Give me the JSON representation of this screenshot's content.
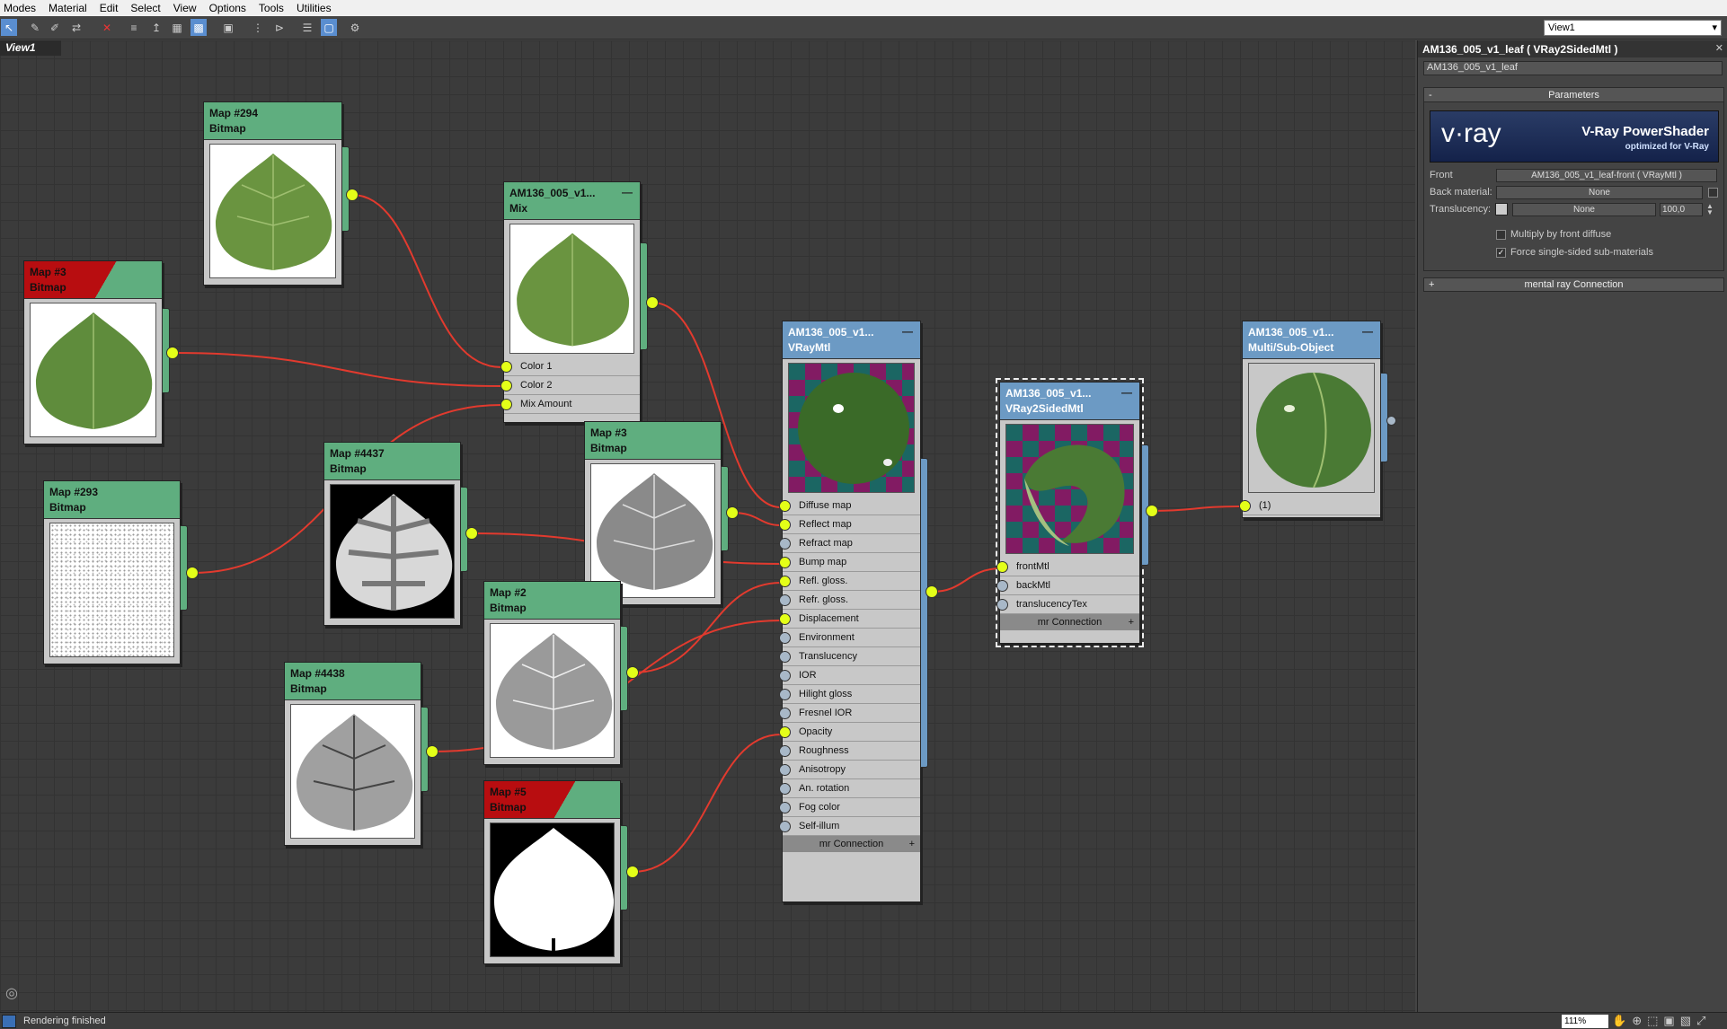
{
  "menu": [
    "Modes",
    "Material",
    "Edit",
    "Select",
    "View",
    "Options",
    "Tools",
    "Utilities"
  ],
  "view_select": "View1",
  "view_tab": "View1",
  "nodes": {
    "map294": {
      "title": "Map #294",
      "type": "Bitmap"
    },
    "map3a": {
      "title": "Map #3",
      "type": "Bitmap"
    },
    "mix": {
      "title": "AM136_005_v1...",
      "type": "Mix",
      "slots": [
        "Color 1",
        "Color 2",
        "Mix Amount"
      ]
    },
    "map293": {
      "title": "Map #293",
      "type": "Bitmap"
    },
    "map4437": {
      "title": "Map #4437",
      "type": "Bitmap"
    },
    "map3b": {
      "title": "Map #3",
      "type": "Bitmap"
    },
    "map2": {
      "title": "Map #2",
      "type": "Bitmap"
    },
    "map4438": {
      "title": "Map #4438",
      "type": "Bitmap"
    },
    "map5": {
      "title": "Map #5",
      "type": "Bitmap"
    },
    "vraymtl": {
      "title": "AM136_005_v1...",
      "type": "VRayMtl",
      "slots": [
        "Diffuse map",
        "Reflect map",
        "Refract map",
        "Bump map",
        "Refl. gloss.",
        "Refr. gloss.",
        "Displacement",
        "Environment",
        "Translucency",
        "IOR",
        "Hilight gloss",
        "Fresnel IOR",
        "Opacity",
        "Roughness",
        "Anisotropy",
        "An. rotation",
        "Fog color",
        "Self-illum"
      ],
      "mr": "mr Connection"
    },
    "twosided": {
      "title": "AM136_005_v1...",
      "type": "VRay2SidedMtl",
      "slots": [
        "frontMtl",
        "backMtl",
        "translucencyTex"
      ],
      "mr": "mr Connection"
    },
    "multi": {
      "title": "AM136_005_v1...",
      "type": "Multi/Sub-Object",
      "slots": [
        "(1)"
      ]
    }
  },
  "panel": {
    "title": "AM136_005_v1_leaf  ( VRay2SidedMtl )",
    "name": "AM136_005_v1_leaf",
    "rollout": "Parameters",
    "banner_logo": "v·ray",
    "banner_title": "V-Ray PowerShader",
    "banner_sub": "optimized for V-Ray",
    "front_label": "Front",
    "front_value": "AM136_005_v1_leaf-front  ( VRayMtl )",
    "back_label": "Back material:",
    "back_value": "None",
    "trans_label": "Translucency:",
    "trans_value": "None",
    "trans_amount": "100,0",
    "opt1": "Multiply by front diffuse",
    "opt2": "Force single-sided sub-materials",
    "mr_rollout": "mental ray Connection"
  },
  "status": "Rendering finished",
  "zoom": "111%"
}
